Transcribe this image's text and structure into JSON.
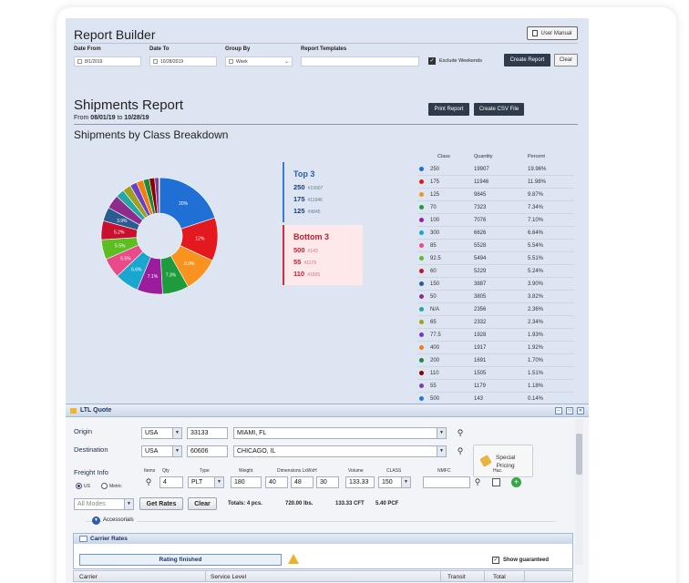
{
  "report_builder": {
    "title": "Report Builder",
    "user_manual_label": "User Manual",
    "date_from_label": "Date From",
    "date_from_value": "8/1/2019",
    "date_to_label": "Date To",
    "date_to_value": "10/28/2019",
    "group_by_label": "Group By",
    "group_by_value": "Week",
    "templates_label": "Report Templates",
    "templates_value": "",
    "exclude_weekends_label": "Exclude Weekends",
    "exclude_weekends_checked": true,
    "create_report_label": "Create Report",
    "clear_label": "Clear"
  },
  "shipments_report": {
    "title": "Shipments Report",
    "from_prefix": "From",
    "from_date": "08/01/19",
    "to_word": "to",
    "to_date": "10/28/19",
    "print_label": "Print Report",
    "csv_label": "Create CSV File",
    "breakdown_title": "Shipments by Class Breakdown"
  },
  "top3": {
    "title": "Top 3",
    "items": [
      {
        "class": "250",
        "qty": "#19907"
      },
      {
        "class": "175",
        "qty": "#11946"
      },
      {
        "class": "125",
        "qty": "#9845"
      }
    ]
  },
  "bottom3": {
    "title": "Bottom 3",
    "items": [
      {
        "class": "500",
        "qty": "#143"
      },
      {
        "class": "55",
        "qty": "#1179"
      },
      {
        "class": "110",
        "qty": "#1505"
      }
    ]
  },
  "class_table": {
    "headers": [
      "Class",
      "Quantity",
      "Percent"
    ],
    "rows": [
      {
        "class": "250",
        "qty": "19907",
        "pct": "19.96%",
        "color": "#1f6fd4"
      },
      {
        "class": "175",
        "qty": "11946",
        "pct": "11.98%",
        "color": "#e4181f"
      },
      {
        "class": "125",
        "qty": "9845",
        "pct": "9.87%",
        "color": "#f7931e"
      },
      {
        "class": "70",
        "qty": "7323",
        "pct": "7.34%",
        "color": "#1e9b3c"
      },
      {
        "class": "100",
        "qty": "7076",
        "pct": "7.10%",
        "color": "#9b1d9e"
      },
      {
        "class": "300",
        "qty": "6626",
        "pct": "6.64%",
        "color": "#19a6cf"
      },
      {
        "class": "85",
        "qty": "5528",
        "pct": "5.54%",
        "color": "#e94a8a"
      },
      {
        "class": "92.5",
        "qty": "5494",
        "pct": "5.51%",
        "color": "#5bbf21"
      },
      {
        "class": "60",
        "qty": "5229",
        "pct": "5.24%",
        "color": "#c8102e"
      },
      {
        "class": "150",
        "qty": "3887",
        "pct": "3.90%",
        "color": "#2a5d8f"
      },
      {
        "class": "50",
        "qty": "3805",
        "pct": "3.82%",
        "color": "#8e2c8e"
      },
      {
        "class": "N/A",
        "qty": "2356",
        "pct": "2.36%",
        "color": "#22a6a6"
      },
      {
        "class": "65",
        "qty": "2332",
        "pct": "2.34%",
        "color": "#a0a020"
      },
      {
        "class": "77.5",
        "qty": "1928",
        "pct": "1.93%",
        "color": "#6a3fc7"
      },
      {
        "class": "400",
        "qty": "1917",
        "pct": "1.92%",
        "color": "#f07f10"
      },
      {
        "class": "200",
        "qty": "1691",
        "pct": "1.70%",
        "color": "#1c8a3a"
      },
      {
        "class": "110",
        "qty": "1505",
        "pct": "1.51%",
        "color": "#8b0000"
      },
      {
        "class": "55",
        "qty": "1179",
        "pct": "1.18%",
        "color": "#7b3fa0"
      },
      {
        "class": "500",
        "qty": "143",
        "pct": "0.14%",
        "color": "#2a78c8"
      }
    ]
  },
  "chart_data": {
    "type": "pie",
    "title": "Shipments by Class Breakdown",
    "categories": [
      "250",
      "175",
      "125",
      "70",
      "100",
      "300",
      "85",
      "92.5",
      "60",
      "150",
      "50",
      "N/A",
      "65",
      "77.5",
      "400",
      "200",
      "110",
      "55",
      "500"
    ],
    "values": [
      19907,
      11946,
      9845,
      7323,
      7076,
      6626,
      5528,
      5494,
      5229,
      3887,
      3805,
      2356,
      2332,
      1928,
      1917,
      1691,
      1505,
      1179,
      143
    ],
    "slice_labels": [
      "20%",
      "12%",
      "9.9%",
      "7.3%",
      "7.1%",
      "6.6%",
      "5.5%",
      "5.5%",
      "5.2%",
      "3.9%",
      "",
      "",
      "",
      "",
      "",
      "",
      "",
      "",
      ""
    ],
    "colors": [
      "#1f6fd4",
      "#e4181f",
      "#f7931e",
      "#1e9b3c",
      "#9b1d9e",
      "#19a6cf",
      "#e94a8a",
      "#5bbf21",
      "#c8102e",
      "#2a5d8f",
      "#8e2c8e",
      "#22a6a6",
      "#a0a020",
      "#6a3fc7",
      "#f07f10",
      "#1c8a3a",
      "#8b0000",
      "#7b3fa0",
      "#2a78c8"
    ],
    "donut": true
  },
  "ltl_quote": {
    "title": "LTL Quote",
    "origin_label": "Origin",
    "origin_country": "USA",
    "origin_zip": "33133",
    "origin_city": "MIAMI, FL",
    "destination_label": "Destination",
    "destination_country": "USA",
    "destination_zip": "60606",
    "destination_city": "CHICAGO, IL",
    "special_pricing_line1": "Special",
    "special_pricing_line2": "Pricing",
    "freight_info_label": "Freight Info",
    "unit_us": "US",
    "unit_metric": "Metric",
    "col_items": "Items",
    "col_qty": "Qty",
    "col_type": "Type",
    "col_weight": "Weight",
    "col_dims": "Dimensions LxWxH",
    "col_volume": "Volume",
    "col_class": "CLASS",
    "col_nmfc": "NMFC",
    "col_haz": "Haz.",
    "qty_value": "4",
    "type_value": "PLT",
    "weight_value": "180",
    "dim_l": "40",
    "dim_w": "48",
    "dim_h": "30",
    "volume_value": "133.33",
    "class_value": "150",
    "nmfc_value": "",
    "modes_value": "All Modes",
    "get_rates_label": "Get Rates",
    "clear_label": "Clear",
    "total_pcs": "Totals: 4 pcs.",
    "total_lbs": "720.00 lbs.",
    "total_cft": "133.33 CFT",
    "total_pcf": "5.40 PCF",
    "accessorials_label": "Accessorials",
    "carrier_rates_label": "Carrier Rates",
    "rating_status": "Rating finished",
    "show_guaranteed_label": "Show guaranteed",
    "grid_headers": [
      "Carrier",
      "Service Level",
      "Transit",
      "Total"
    ]
  }
}
